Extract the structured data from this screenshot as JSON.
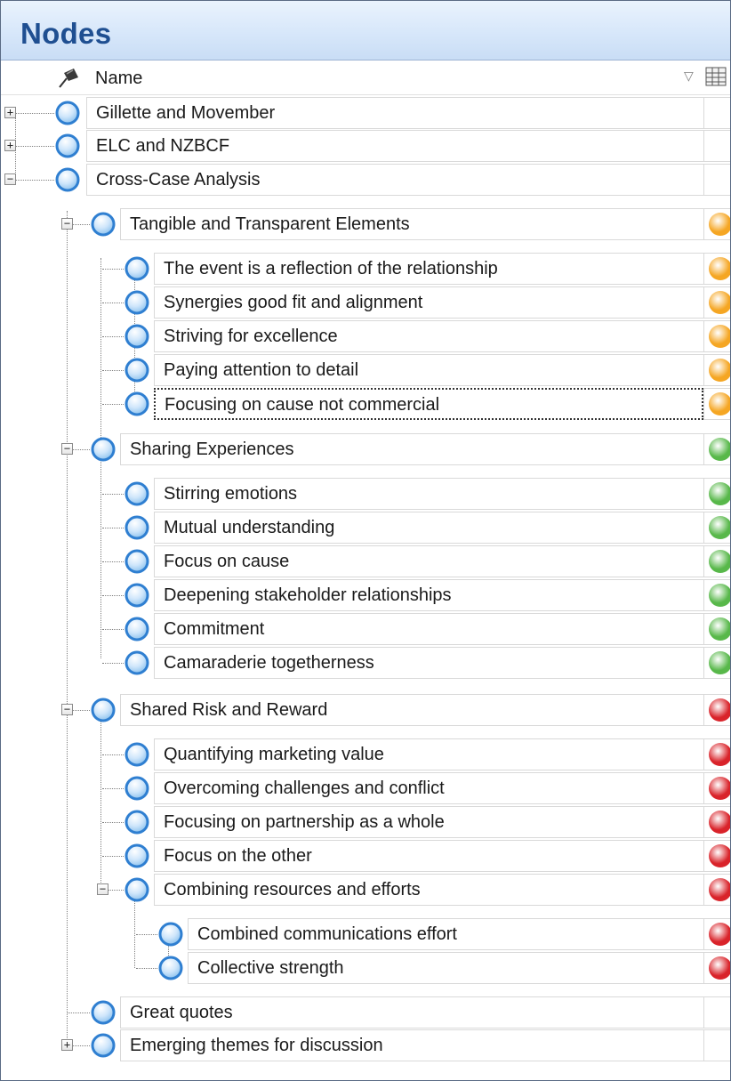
{
  "panel": {
    "title": "Nodes",
    "column_header": "Name",
    "sort_icon": "sort-triangle-icon",
    "columns_icon": "column-chooser-icon"
  },
  "colors": {
    "title_text": "#1f4f91",
    "orange": "#f5a623",
    "green": "#58b84a",
    "red": "#d9232a",
    "node_blue": "#2f7fd1"
  },
  "nodes": [
    {
      "label": "Gillette and Movember",
      "level": 0,
      "toggle": "+",
      "color": null
    },
    {
      "label": "ELC and NZBCF",
      "level": 0,
      "toggle": "+",
      "color": null
    },
    {
      "label": "Cross-Case Analysis",
      "level": 0,
      "toggle": "−",
      "color": null
    },
    {
      "label": "Tangible and Transparent Elements",
      "level": 1,
      "toggle": "−",
      "color": "orange"
    },
    {
      "label": "The event is a reflection of the relationship",
      "level": 2,
      "toggle": null,
      "color": "orange"
    },
    {
      "label": "Synergies good fit and alignment",
      "level": 2,
      "toggle": null,
      "color": "orange"
    },
    {
      "label": "Striving for excellence",
      "level": 2,
      "toggle": null,
      "color": "orange"
    },
    {
      "label": "Paying attention to detail",
      "level": 2,
      "toggle": null,
      "color": "orange"
    },
    {
      "label": "Focusing on cause not commercial",
      "level": 2,
      "toggle": null,
      "color": "orange",
      "focused": true
    },
    {
      "label": "Sharing Experiences",
      "level": 1,
      "toggle": "−",
      "color": "green"
    },
    {
      "label": "Stirring emotions",
      "level": 2,
      "toggle": null,
      "color": "green"
    },
    {
      "label": "Mutual understanding",
      "level": 2,
      "toggle": null,
      "color": "green"
    },
    {
      "label": "Focus on cause",
      "level": 2,
      "toggle": null,
      "color": "green"
    },
    {
      "label": "Deepening stakeholder relationships",
      "level": 2,
      "toggle": null,
      "color": "green"
    },
    {
      "label": "Commitment",
      "level": 2,
      "toggle": null,
      "color": "green"
    },
    {
      "label": "Camaraderie togetherness",
      "level": 2,
      "toggle": null,
      "color": "green"
    },
    {
      "label": "Shared Risk and Reward",
      "level": 1,
      "toggle": "−",
      "color": "red"
    },
    {
      "label": "Quantifying marketing value",
      "level": 2,
      "toggle": null,
      "color": "red"
    },
    {
      "label": "Overcoming challenges and conflict",
      "level": 2,
      "toggle": null,
      "color": "red"
    },
    {
      "label": "Focusing on partnership as a whole",
      "level": 2,
      "toggle": null,
      "color": "red"
    },
    {
      "label": "Focus on the other",
      "level": 2,
      "toggle": null,
      "color": "red"
    },
    {
      "label": "Combining resources and efforts",
      "level": 2,
      "toggle": "−",
      "color": "red"
    },
    {
      "label": "Combined communications effort",
      "level": 3,
      "toggle": null,
      "color": "red"
    },
    {
      "label": "Collective strength",
      "level": 3,
      "toggle": null,
      "color": "red"
    },
    {
      "label": "Great quotes",
      "level": 1,
      "toggle": null,
      "color": null
    },
    {
      "label": "Emerging themes for discussion",
      "level": 1,
      "toggle": "+",
      "color": null
    }
  ]
}
